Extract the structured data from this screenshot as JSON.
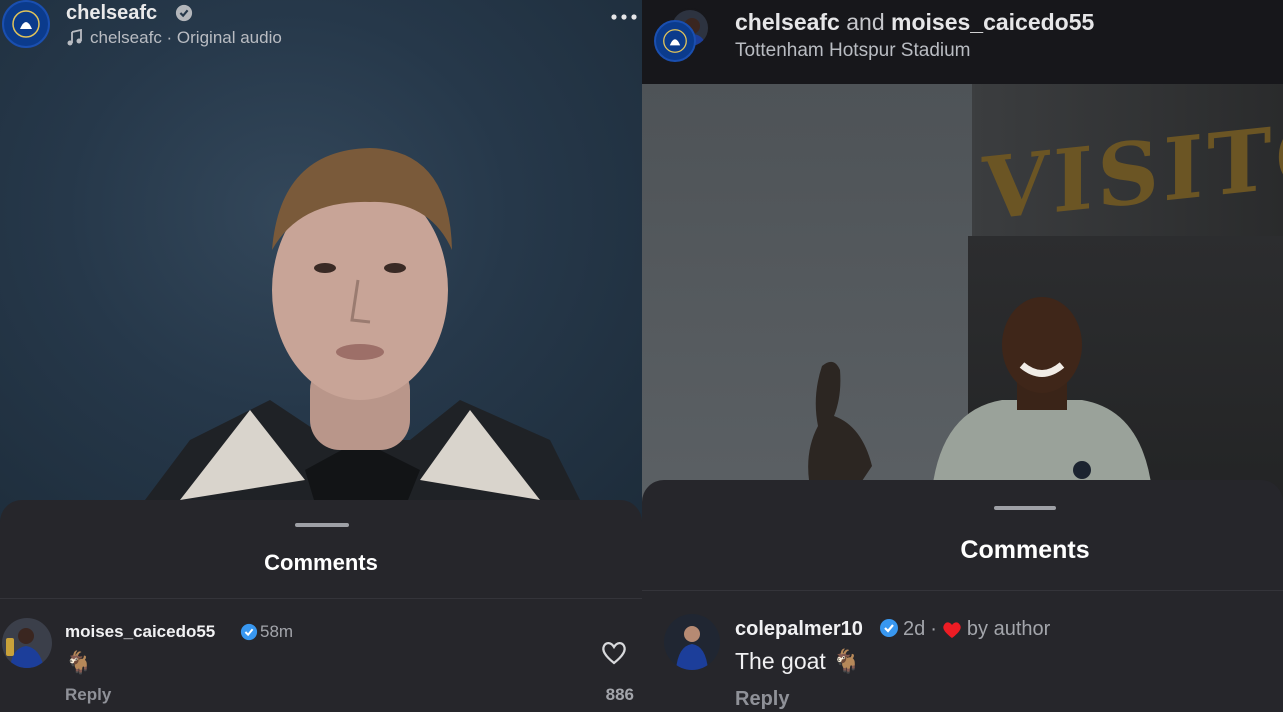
{
  "left": {
    "header": {
      "username": "chelseafc",
      "audio": "chelseafc · Original audio",
      "more_icon": "more-dots-icon",
      "verified_icon": "verified-grey-icon"
    },
    "comments": {
      "title": "Comments",
      "items": [
        {
          "username": "moises_caicedo55",
          "verified": true,
          "time": "58m",
          "text": "🐐",
          "reply_label": "Reply",
          "like_count": "886"
        }
      ]
    }
  },
  "right": {
    "header": {
      "username": "chelseafc",
      "and_text": "and",
      "collaborator": "moises_caicedo55",
      "location": "Tottenham Hotspur Stadium"
    },
    "video": {
      "sign_text": "VISITO"
    },
    "comments": {
      "title": "Comments",
      "items": [
        {
          "username": "colepalmer10",
          "verified": true,
          "time": "2d",
          "separator": "·",
          "by_author": "by author",
          "text": "The goat 🐐",
          "reply_label": "Reply"
        }
      ]
    }
  },
  "colors": {
    "sheet_bg": "#26262b",
    "verified_blue": "#3897f0",
    "heart_red": "#ed1c24",
    "chelsea_blue": "#0b3b8c"
  }
}
